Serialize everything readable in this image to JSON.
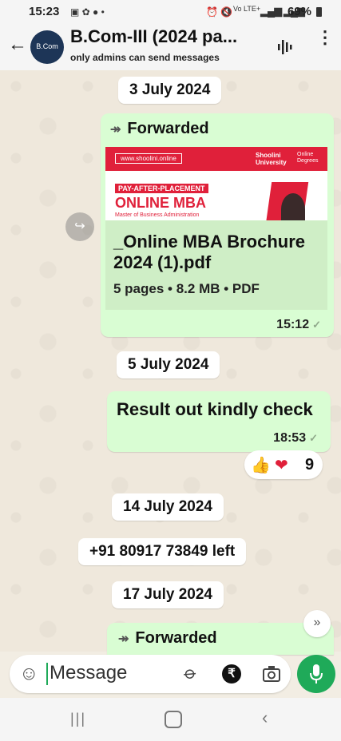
{
  "status": {
    "time": "15:23",
    "battery": "69%",
    "network": "Vo LTE+"
  },
  "chat": {
    "title": "B.Com-III (2024 pa...",
    "subtitle": "only admins can send messages",
    "avatar_text": "B.Com"
  },
  "messages": {
    "date1": "3 July 2024",
    "m1_forwarded": "Forwarded",
    "doc_url": "www.shoolini.online",
    "doc_brand": "Shoolini University",
    "doc_brand2": "Online Degrees",
    "doc_banner": "PAY-AFTER-PLACEMENT",
    "doc_heading": "ONLINE MBA",
    "doc_sub": "Master of Business Administration",
    "doc_name": "_Online MBA Brochure 2024 (1).pdf",
    "doc_meta": "5 pages • 8.2 MB • PDF",
    "m1_time": "15:12",
    "date2": "5 July 2024",
    "m2_text": "Result out kindly check",
    "m2_time": "18:53",
    "reaction_count": "9",
    "date3": "14 July 2024",
    "system_left": "+91 80917 73849 left",
    "date4": "17 July 2024",
    "m3_forwarded": "Forwarded"
  },
  "input": {
    "placeholder": "Message"
  },
  "colors": {
    "bubble": "#d9fdd3",
    "accent": "#1faa59",
    "banner_red": "#e0203a"
  }
}
